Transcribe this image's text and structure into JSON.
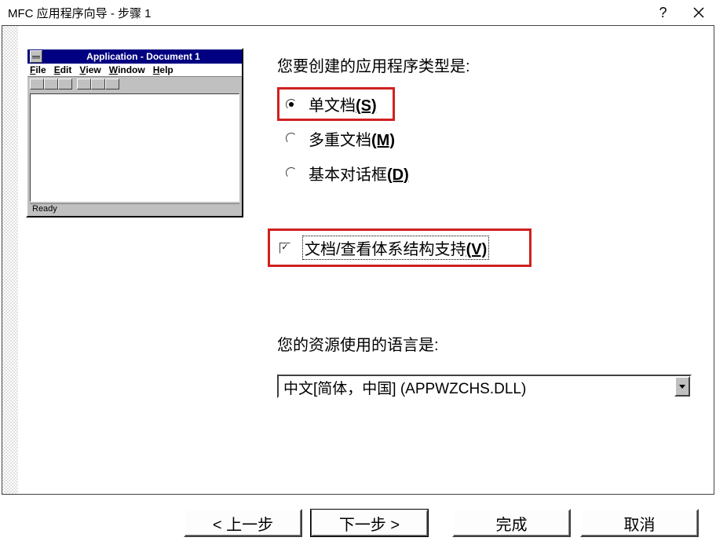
{
  "titlebar": {
    "title": "MFC 应用程序向导 - 步骤 1",
    "help_symbol": "?"
  },
  "preview": {
    "window_title": "Application - Document 1",
    "menus": {
      "file": "File",
      "edit": "Edit",
      "view": "View",
      "window": "Window",
      "help": "Help"
    },
    "status": "Ready"
  },
  "question_apptype": "您要创建的应用程序类型是:",
  "options": {
    "single": {
      "label": "单文档",
      "hotkey": "(S)"
    },
    "multi": {
      "label": "多重文档",
      "hotkey": "(M)"
    },
    "dialog": {
      "label": "基本对话框",
      "hotkey": "(D)"
    }
  },
  "docview_checkbox": {
    "label": "文档/查看体系结构支持",
    "hotkey": "(V)"
  },
  "question_language": "您的资源使用的语言是:",
  "language_combo": {
    "selected": "中文[简体，中国] (APPWZCHS.DLL)"
  },
  "buttons": {
    "back": "< 上一步",
    "next": "下一步 >",
    "finish": "完成",
    "cancel": "取消"
  }
}
